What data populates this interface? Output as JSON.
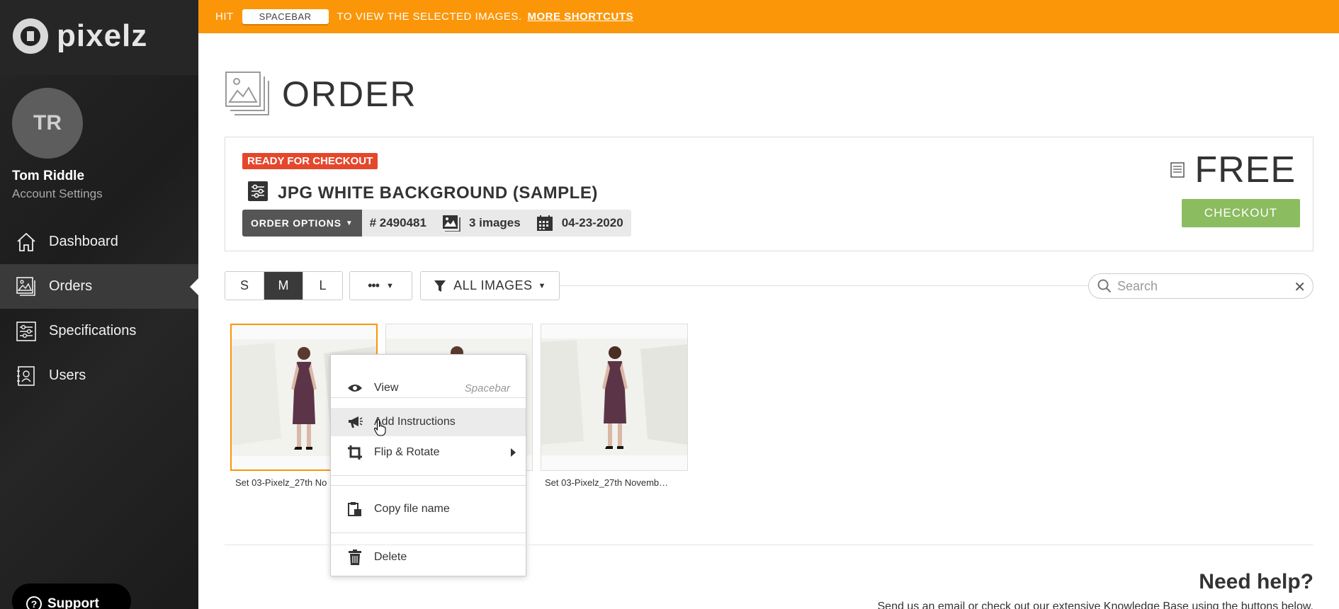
{
  "brand": {
    "name": "pixelz"
  },
  "user": {
    "initials": "TR",
    "name": "Tom Riddle",
    "account_link": "Account Settings"
  },
  "sidebar": {
    "items": [
      {
        "label": "Dashboard",
        "icon": "home-icon",
        "active": false
      },
      {
        "label": "Orders",
        "icon": "images-icon",
        "active": true
      },
      {
        "label": "Specifications",
        "icon": "sliders-icon",
        "active": false
      },
      {
        "label": "Users",
        "icon": "contacts-icon",
        "active": false
      }
    ],
    "support_label": "Support"
  },
  "banner": {
    "prefix": "HIT",
    "key": "SPACEBAR",
    "suffix": "TO VIEW THE SELECTED IMAGES.",
    "link": "MORE SHORTCUTS"
  },
  "page": {
    "title": "ORDER"
  },
  "order": {
    "status": "READY FOR CHECKOUT",
    "title": "JPG WHITE BACKGROUND (SAMPLE)",
    "options_label": "ORDER OPTIONS",
    "number": "# 2490481",
    "images": "3 images",
    "date": "04-23-2020",
    "price": "FREE",
    "checkout_label": "CHECKOUT",
    "status_color": "#e5472c",
    "checkout_color": "#8bbc5f"
  },
  "toolbar": {
    "sizes": [
      "S",
      "M",
      "L"
    ],
    "active_size": "M",
    "more_label": "•••",
    "filter_label": "ALL IMAGES",
    "search_placeholder": "Search",
    "search_value": ""
  },
  "thumbnails": [
    {
      "caption": "Set 03-Pixelz_27th No",
      "selected": true
    },
    {
      "caption": "",
      "selected": false
    },
    {
      "caption": "Set 03-Pixelz_27th Novemb…",
      "selected": false
    }
  ],
  "context_menu": {
    "items": [
      {
        "label": "View",
        "shortcut": "Spacebar",
        "icon": "eye-icon"
      },
      {
        "label": "Add Instructions",
        "icon": "megaphone-icon"
      },
      {
        "label": "Flip & Rotate",
        "icon": "crop-icon",
        "submenu": true
      },
      {
        "label": "Copy file name",
        "icon": "clipboard-icon"
      },
      {
        "label": "Delete",
        "icon": "trash-icon"
      }
    ]
  },
  "help": {
    "title": "Need help?",
    "text": "Send us an email or check out our extensive Knowledge Base using the buttons below."
  },
  "colors": {
    "accent": "#fb9608",
    "sidebar": "#222222"
  }
}
